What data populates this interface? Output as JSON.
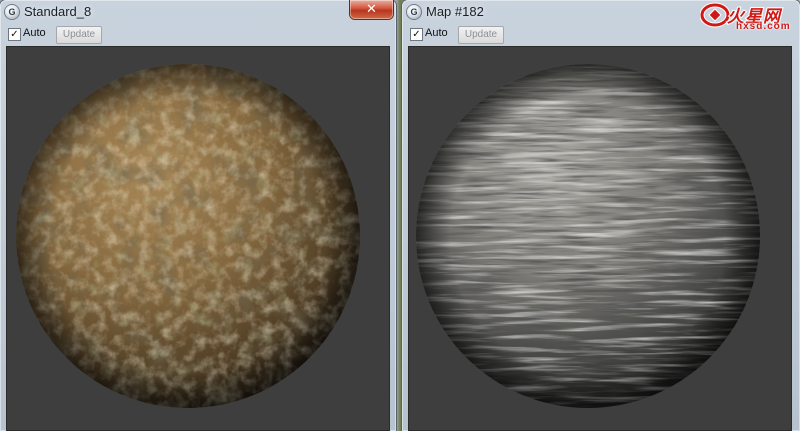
{
  "windows": [
    {
      "title": "Standard_8",
      "app_icon": "3ds-max-icon",
      "close_glyph": "✕",
      "checkbox_glyph": "✓",
      "auto_label": "Auto",
      "auto_checked": true,
      "update_label": "Update",
      "update_enabled": false,
      "preview": {
        "material": "dirt-ground-sphere",
        "base_color": "#8b6a3e"
      }
    },
    {
      "title": "Map #182",
      "app_icon": "3ds-max-icon",
      "checkbox_glyph": "✓",
      "auto_label": "Auto",
      "auto_checked": true,
      "update_label": "Update",
      "update_enabled": false,
      "preview": {
        "material": "layered-rock-sphere",
        "base_color": "#6e6e6a"
      }
    }
  ],
  "watermark": {
    "text": "火星网",
    "url": "hxsd.com",
    "logo": "hxsd-logo-icon",
    "color": "#d01916"
  }
}
